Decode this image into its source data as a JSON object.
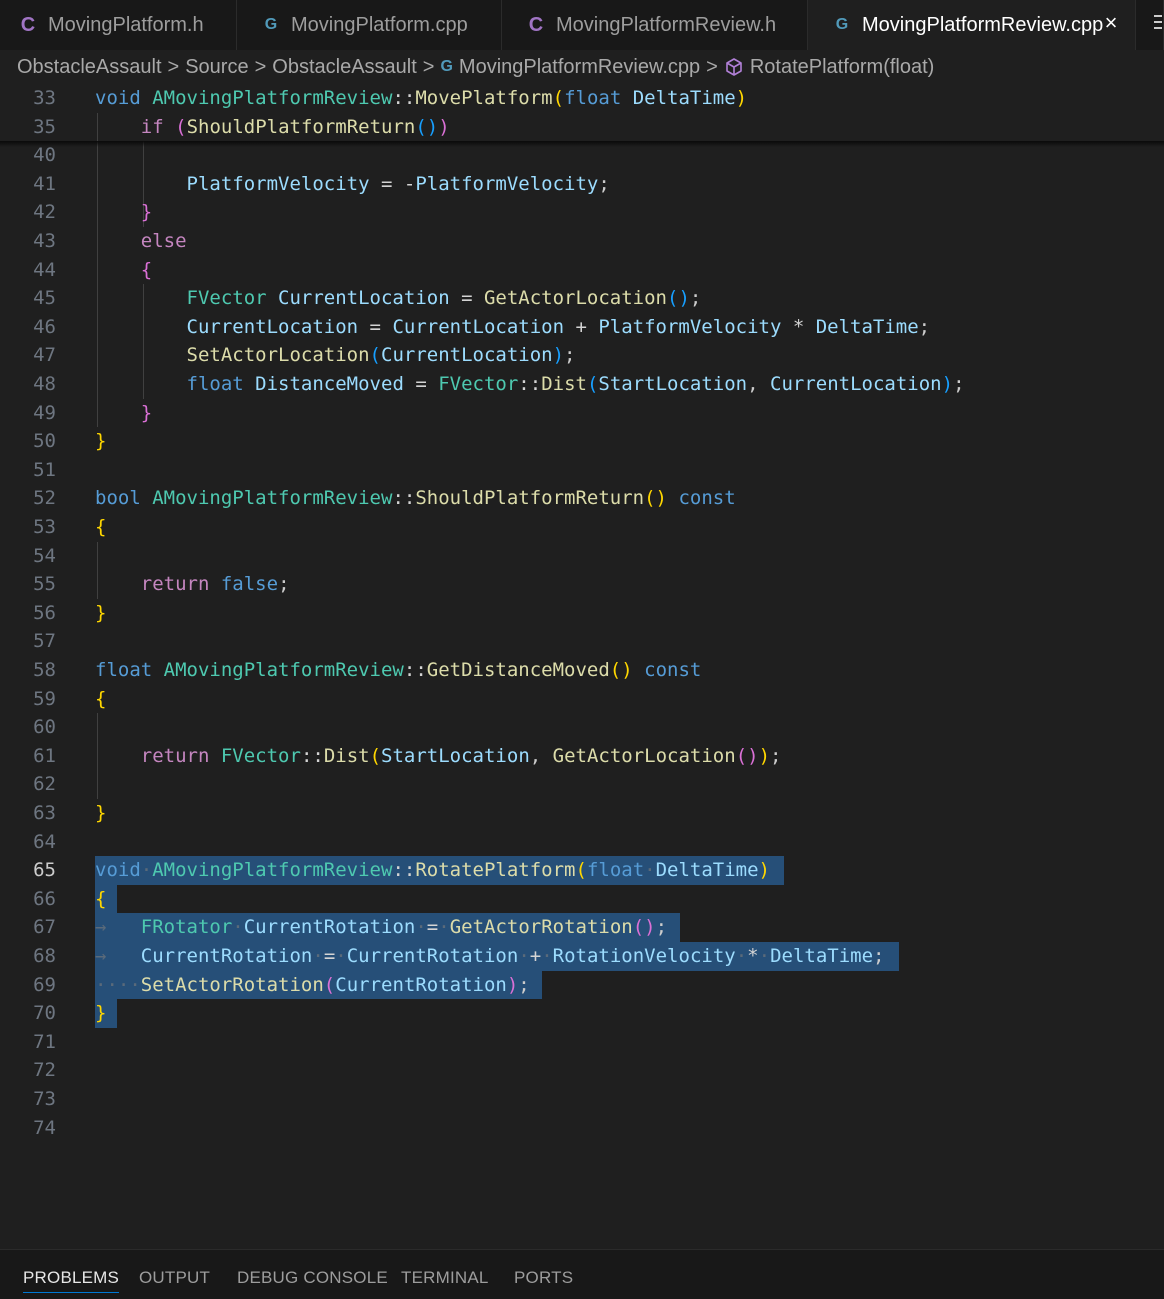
{
  "tabs": [
    {
      "label": "MovingPlatform.h",
      "icon": "C",
      "icon_name": "c-header-icon"
    },
    {
      "label": "MovingPlatform.cpp",
      "icon": "G",
      "icon_name": "cpp-file-icon"
    },
    {
      "label": "MovingPlatformReview.h",
      "icon": "C",
      "icon_name": "c-header-icon"
    },
    {
      "label": "MovingPlatformReview.cpp",
      "icon": "G",
      "icon_name": "cpp-file-icon",
      "active": true
    }
  ],
  "tab_close_glyph": "×",
  "breadcrumb": {
    "items": [
      "ObstacleAssault",
      "Source",
      "ObstacleAssault",
      "MovingPlatformReview.cpp",
      "RotatePlatform(float)"
    ],
    "separator": ">"
  },
  "editor": {
    "current_line": "65",
    "lines": [
      {
        "n": "33",
        "t": [
          [
            "kw",
            "void"
          ],
          [
            "op",
            " "
          ],
          [
            "ty",
            "AMovingPlatformReview"
          ],
          [
            "op",
            "::"
          ],
          [
            "fn",
            "MovePlatform"
          ],
          [
            "b1",
            "("
          ],
          [
            "kw",
            "float"
          ],
          [
            "op",
            " "
          ],
          [
            "va",
            "DeltaTime"
          ],
          [
            "b1",
            ")"
          ]
        ]
      },
      {
        "n": "35",
        "t": [
          [
            "op",
            "    "
          ],
          [
            "kw2",
            "if"
          ],
          [
            "op",
            " "
          ],
          [
            "b2",
            "("
          ],
          [
            "fn",
            "ShouldPlatformReturn"
          ],
          [
            "b3",
            "()"
          ],
          [
            "b2",
            ")"
          ]
        ]
      },
      {
        "n": "40",
        "t": []
      },
      {
        "n": "41",
        "t": [
          [
            "op",
            "        "
          ],
          [
            "va",
            "PlatformVelocity"
          ],
          [
            "op",
            " = -"
          ],
          [
            "va",
            "PlatformVelocity"
          ],
          [
            "pu",
            ";"
          ]
        ]
      },
      {
        "n": "42",
        "t": [
          [
            "op",
            "    "
          ],
          [
            "b2",
            "}"
          ]
        ]
      },
      {
        "n": "43",
        "t": [
          [
            "op",
            "    "
          ],
          [
            "kw2",
            "else"
          ]
        ]
      },
      {
        "n": "44",
        "t": [
          [
            "op",
            "    "
          ],
          [
            "b2",
            "{"
          ]
        ]
      },
      {
        "n": "45",
        "t": [
          [
            "op",
            "        "
          ],
          [
            "ty",
            "FVector"
          ],
          [
            "op",
            " "
          ],
          [
            "va",
            "CurrentLocation"
          ],
          [
            "op",
            " = "
          ],
          [
            "fn",
            "GetActorLocation"
          ],
          [
            "b3",
            "()"
          ],
          [
            "pu",
            ";"
          ]
        ]
      },
      {
        "n": "46",
        "t": [
          [
            "op",
            "        "
          ],
          [
            "va",
            "CurrentLocation"
          ],
          [
            "op",
            " = "
          ],
          [
            "va",
            "CurrentLocation"
          ],
          [
            "op",
            " + "
          ],
          [
            "va",
            "PlatformVelocity"
          ],
          [
            "op",
            " * "
          ],
          [
            "va",
            "DeltaTime"
          ],
          [
            "pu",
            ";"
          ]
        ]
      },
      {
        "n": "47",
        "t": [
          [
            "op",
            "        "
          ],
          [
            "fn",
            "SetActorLocation"
          ],
          [
            "b3",
            "("
          ],
          [
            "va",
            "CurrentLocation"
          ],
          [
            "b3",
            ")"
          ],
          [
            "pu",
            ";"
          ]
        ]
      },
      {
        "n": "48",
        "t": [
          [
            "op",
            "        "
          ],
          [
            "kw",
            "float"
          ],
          [
            "op",
            " "
          ],
          [
            "va",
            "DistanceMoved"
          ],
          [
            "op",
            " = "
          ],
          [
            "ty",
            "FVector"
          ],
          [
            "op",
            "::"
          ],
          [
            "fn",
            "Dist"
          ],
          [
            "b3",
            "("
          ],
          [
            "va",
            "StartLocation"
          ],
          [
            "pu",
            ", "
          ],
          [
            "va",
            "CurrentLocation"
          ],
          [
            "b3",
            ")"
          ],
          [
            "pu",
            ";"
          ]
        ]
      },
      {
        "n": "49",
        "t": [
          [
            "op",
            "    "
          ],
          [
            "b2",
            "}"
          ]
        ]
      },
      {
        "n": "50",
        "t": [
          [
            "b1",
            "}"
          ]
        ]
      },
      {
        "n": "51",
        "t": []
      },
      {
        "n": "52",
        "t": [
          [
            "kw",
            "bool"
          ],
          [
            "op",
            " "
          ],
          [
            "ty",
            "AMovingPlatformReview"
          ],
          [
            "op",
            "::"
          ],
          [
            "fn",
            "ShouldPlatformReturn"
          ],
          [
            "b1",
            "()"
          ],
          [
            "op",
            " "
          ],
          [
            "kw",
            "const"
          ]
        ]
      },
      {
        "n": "53",
        "t": [
          [
            "b1",
            "{"
          ]
        ]
      },
      {
        "n": "54",
        "t": []
      },
      {
        "n": "55",
        "t": [
          [
            "op",
            "    "
          ],
          [
            "kw2",
            "return"
          ],
          [
            "op",
            " "
          ],
          [
            "kw",
            "false"
          ],
          [
            "pu",
            ";"
          ]
        ]
      },
      {
        "n": "56",
        "t": [
          [
            "b1",
            "}"
          ]
        ]
      },
      {
        "n": "57",
        "t": []
      },
      {
        "n": "58",
        "t": [
          [
            "kw",
            "float"
          ],
          [
            "op",
            " "
          ],
          [
            "ty",
            "AMovingPlatformReview"
          ],
          [
            "op",
            "::"
          ],
          [
            "fn",
            "GetDistanceMoved"
          ],
          [
            "b1",
            "()"
          ],
          [
            "op",
            " "
          ],
          [
            "kw",
            "const"
          ]
        ]
      },
      {
        "n": "59",
        "t": [
          [
            "b1",
            "{"
          ]
        ]
      },
      {
        "n": "60",
        "t": []
      },
      {
        "n": "61",
        "t": [
          [
            "op",
            "    "
          ],
          [
            "kw2",
            "return"
          ],
          [
            "op",
            " "
          ],
          [
            "ty",
            "FVector"
          ],
          [
            "op",
            "::"
          ],
          [
            "fn",
            "Dist"
          ],
          [
            "b1",
            "("
          ],
          [
            "va",
            "StartLocation"
          ],
          [
            "pu",
            ", "
          ],
          [
            "fn",
            "GetActorLocation"
          ],
          [
            "b2",
            "()"
          ],
          [
            "b1",
            ")"
          ],
          [
            "pu",
            ";"
          ]
        ]
      },
      {
        "n": "62",
        "t": []
      },
      {
        "n": "63",
        "t": [
          [
            "b1",
            "}"
          ]
        ]
      },
      {
        "n": "64",
        "t": []
      },
      {
        "n": "65",
        "t": [
          [
            "kw",
            "void"
          ],
          [
            "ws",
            "·"
          ],
          [
            "ty",
            "AMovingPlatformReview"
          ],
          [
            "op",
            "::"
          ],
          [
            "fn",
            "RotatePlatform"
          ],
          [
            "b1",
            "("
          ],
          [
            "kw",
            "float"
          ],
          [
            "ws",
            "·"
          ],
          [
            "va",
            "DeltaTime"
          ],
          [
            "b1",
            ")"
          ]
        ]
      },
      {
        "n": "66",
        "t": [
          [
            "b1",
            "{"
          ]
        ]
      },
      {
        "n": "67",
        "t": [
          [
            "ws",
            "→   "
          ],
          [
            "ty",
            "FRotator"
          ],
          [
            "ws",
            "·"
          ],
          [
            "va",
            "CurrentRotation"
          ],
          [
            "ws",
            "·"
          ],
          [
            "op",
            "="
          ],
          [
            "ws",
            "·"
          ],
          [
            "fn",
            "GetActorRotation"
          ],
          [
            "b2",
            "()"
          ],
          [
            "pu",
            ";"
          ]
        ]
      },
      {
        "n": "68",
        "t": [
          [
            "ws",
            "→   "
          ],
          [
            "va",
            "CurrentRotation"
          ],
          [
            "ws",
            "·"
          ],
          [
            "op",
            "="
          ],
          [
            "ws",
            "·"
          ],
          [
            "va",
            "CurrentRotation"
          ],
          [
            "ws",
            "·"
          ],
          [
            "op",
            "+"
          ],
          [
            "ws",
            "·"
          ],
          [
            "va",
            "RotationVelocity"
          ],
          [
            "ws",
            "·"
          ],
          [
            "op",
            "*"
          ],
          [
            "ws",
            "·"
          ],
          [
            "va",
            "DeltaTime"
          ],
          [
            "pu",
            ";"
          ]
        ]
      },
      {
        "n": "69",
        "t": [
          [
            "ws",
            "····"
          ],
          [
            "fn",
            "SetActorRotation"
          ],
          [
            "b2",
            "("
          ],
          [
            "va",
            "CurrentRotation"
          ],
          [
            "b2",
            ")"
          ],
          [
            "pu",
            ";"
          ]
        ]
      },
      {
        "n": "70",
        "t": [
          [
            "b1",
            "}"
          ]
        ]
      },
      {
        "n": "71",
        "t": []
      },
      {
        "n": "72",
        "t": []
      },
      {
        "n": "73",
        "t": []
      },
      {
        "n": "74",
        "t": []
      }
    ]
  },
  "panel_tabs": [
    {
      "label": "PROBLEMS",
      "active": true
    },
    {
      "label": "OUTPUT"
    },
    {
      "label": "DEBUG CONSOLE"
    },
    {
      "label": "TERMINAL"
    },
    {
      "label": "PORTS"
    }
  ],
  "colors": {
    "background": "#1f1f1f",
    "selection": "#264f78",
    "accent": "#0078d4"
  }
}
